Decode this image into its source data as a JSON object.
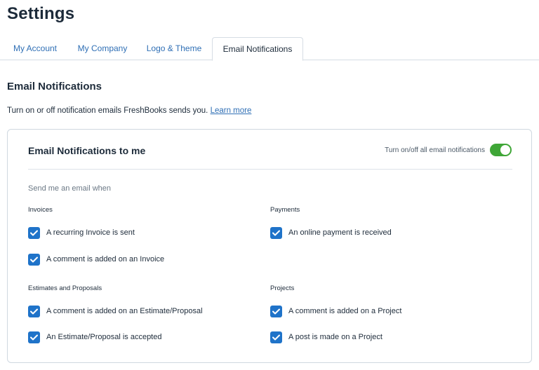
{
  "page_title": "Settings",
  "tabs": [
    {
      "label": "My Account"
    },
    {
      "label": "My Company"
    },
    {
      "label": "Logo & Theme"
    },
    {
      "label": "Email Notifications",
      "active": true
    }
  ],
  "section": {
    "title": "Email Notifications",
    "intro": "Turn on or off notification emails FreshBooks sends you.",
    "learn_more": "Learn more"
  },
  "card": {
    "title": "Email Notifications to me",
    "toggle_label": "Turn on/off all email notifications",
    "toggle_on": true,
    "toggle_color": "#3fa637",
    "subhead": "Send me an email when",
    "checkbox_color": "#1f73c9",
    "groups": {
      "invoices": {
        "label": "Invoices",
        "items": [
          {
            "label": "A recurring Invoice is sent",
            "checked": true
          },
          {
            "label": "A comment is added on an Invoice",
            "checked": true
          }
        ]
      },
      "payments": {
        "label": "Payments",
        "items": [
          {
            "label": "An online payment is received",
            "checked": true
          }
        ]
      },
      "estimates": {
        "label": "Estimates and Proposals",
        "items": [
          {
            "label": "A comment is added on an Estimate/Proposal",
            "checked": true
          },
          {
            "label": "An Estimate/Proposal is accepted",
            "checked": true
          }
        ]
      },
      "projects": {
        "label": "Projects",
        "items": [
          {
            "label": "A comment is added on a Project",
            "checked": true
          },
          {
            "label": "A post is made on a Project",
            "checked": true
          }
        ]
      }
    }
  }
}
